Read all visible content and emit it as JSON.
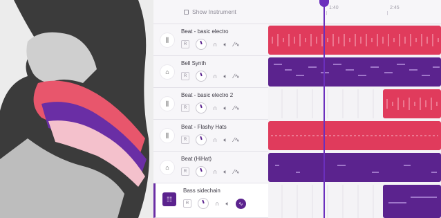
{
  "header": {
    "show_instrument_label": "Show Instrument",
    "ruler": [
      "1:40",
      "2:45"
    ]
  },
  "tracks": [
    {
      "name": "Beat - basic electro",
      "icon": "waveform-icon",
      "r_label": "R",
      "color": "#e03b5c",
      "selected": false
    },
    {
      "name": "Bell Synth",
      "icon": "bell-icon",
      "r_label": "R",
      "color": "#5b238e",
      "selected": false
    },
    {
      "name": "Beat - basic electro 2",
      "icon": "waveform-icon",
      "r_label": "R",
      "color": "#e03b5c",
      "selected": false
    },
    {
      "name": "Beat - Flashy Hats",
      "icon": "waveform-icon",
      "r_label": "R",
      "color": "#e03b5c",
      "selected": false
    },
    {
      "name": "Beat (HiHat)",
      "icon": "bell-icon",
      "r_label": "R",
      "color": "#5b238e",
      "selected": false
    },
    {
      "name": "Bass sidechain",
      "icon": "piano-icon",
      "r_label": "R",
      "color": "#5b238e",
      "selected": true
    }
  ],
  "colors": {
    "accent": "#6b2fbd",
    "beat_red": "#e03b5c",
    "synth_purple": "#5b238e"
  }
}
